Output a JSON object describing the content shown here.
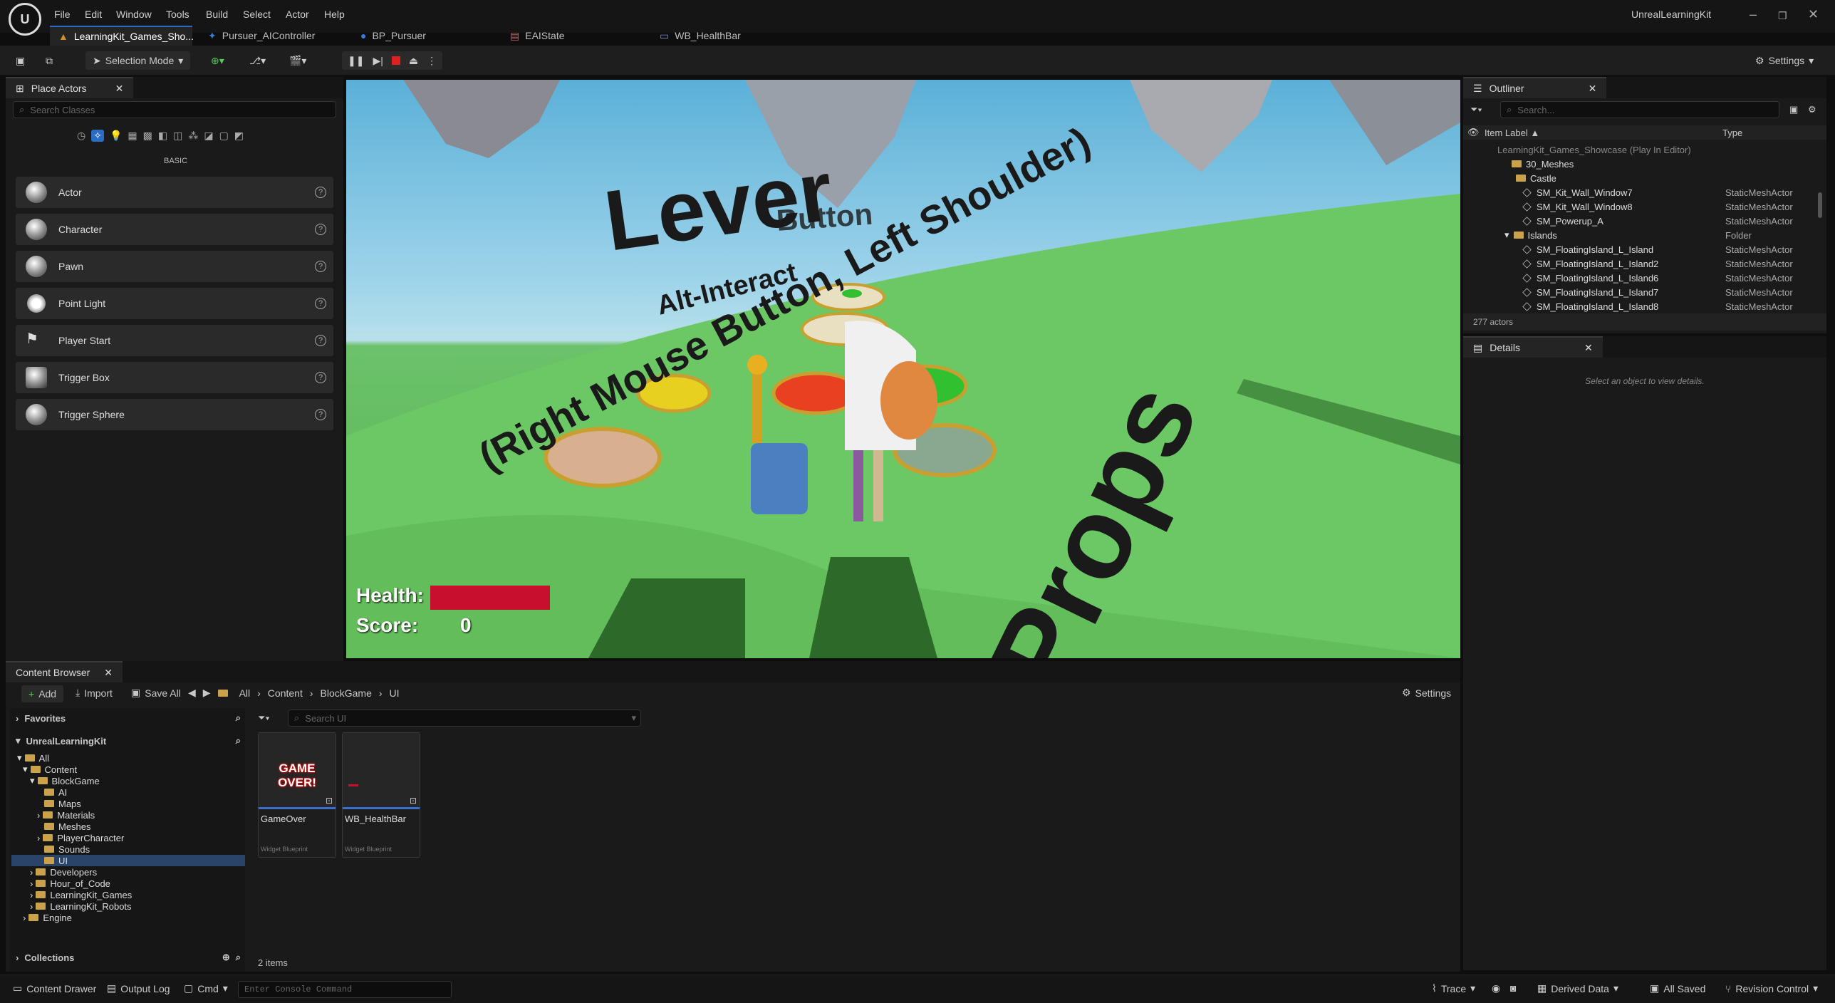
{
  "app": {
    "title": "UnrealLearningKit"
  },
  "menu": [
    "File",
    "Edit",
    "Window",
    "Tools",
    "Build",
    "Select",
    "Actor",
    "Help"
  ],
  "tabs": [
    {
      "label": "LearningKit_Games_Sho..."
    },
    {
      "label": "Pursuer_AIController"
    },
    {
      "label": "BP_Pursuer"
    },
    {
      "label": "EAIState"
    },
    {
      "label": "WB_HealthBar"
    }
  ],
  "toolbar": {
    "mode_label": "Selection Mode",
    "settings_label": "Settings"
  },
  "place_actors": {
    "tab_label": "Place Actors",
    "search_placeholder": "Search Classes",
    "category_label": "BASIC",
    "items": [
      {
        "label": "Actor"
      },
      {
        "label": "Character"
      },
      {
        "label": "Pawn"
      },
      {
        "label": "Point Light"
      },
      {
        "label": "Player Start"
      },
      {
        "label": "Trigger Box"
      },
      {
        "label": "Trigger Sphere"
      }
    ]
  },
  "viewport": {
    "hud": {
      "health_label": "Health:",
      "score_label": "Score:",
      "score_value": "0",
      "health_fraction": 1.0
    },
    "scene_text": {
      "lever": "Lever",
      "button": "Button",
      "alt_interact": "Alt-Interact",
      "mouse_hint": "(Right Mouse Button, Left Shoulder)",
      "props": "Props"
    }
  },
  "outliner": {
    "tab_label": "Outliner",
    "search_placeholder": "Search...",
    "col_label": "Item Label ▲",
    "col_type": "Type",
    "rows": [
      {
        "label": "LearningKit_Games_Showcase (Play In Editor)",
        "type": ""
      },
      {
        "label": "30_Meshes",
        "type": ""
      },
      {
        "label": "Castle",
        "type": ""
      },
      {
        "label": "SM_Kit_Wall_Window7",
        "type": "StaticMeshActor"
      },
      {
        "label": "SM_Kit_Wall_Window8",
        "type": "StaticMeshActor"
      },
      {
        "label": "SM_Powerup_A",
        "type": "StaticMeshActor"
      },
      {
        "label": "Islands",
        "type": "Folder"
      },
      {
        "label": "SM_FloatingIsland_L_Island",
        "type": "StaticMeshActor"
      },
      {
        "label": "SM_FloatingIsland_L_Island2",
        "type": "StaticMeshActor"
      },
      {
        "label": "SM_FloatingIsland_L_Island6",
        "type": "StaticMeshActor"
      },
      {
        "label": "SM_FloatingIsland_L_Island7",
        "type": "StaticMeshActor"
      },
      {
        "label": "SM_FloatingIsland_L_Island8",
        "type": "StaticMeshActor"
      }
    ],
    "count": "277 actors"
  },
  "details": {
    "tab_label": "Details",
    "empty": "Select an object to view details."
  },
  "content_browser": {
    "tab_label": "Content Browser",
    "add_label": "Add",
    "import_label": "Import",
    "save_all_label": "Save All",
    "breadcrumb": [
      "All",
      "Content",
      "BlockGame",
      "UI"
    ],
    "settings_label": "Settings",
    "favorites_label": "Favorites",
    "project_label": "UnrealLearningKit",
    "search_placeholder": "Search UI",
    "tree": [
      "All",
      "Content",
      "BlockGame",
      "AI",
      "Maps",
      "Materials",
      "Meshes",
      "PlayerCharacter",
      "Sounds",
      "UI",
      "Developers",
      "Hour_of_Code",
      "LearningKit_Games",
      "LearningKit_Robots",
      "Engine"
    ],
    "collections_label": "Collections",
    "assets": [
      {
        "name": "GameOver",
        "type": "Widget Blueprint",
        "thumb_text": "GAME OVER!"
      },
      {
        "name": "WB_HealthBar",
        "type": "Widget Blueprint",
        "thumb_text": ""
      }
    ],
    "item_count": "2 items"
  },
  "statusbar": {
    "content_drawer": "Content Drawer",
    "output_log": "Output Log",
    "cmd": "Cmd",
    "console_placeholder": "Enter Console Command",
    "trace": "Trace",
    "derived_data": "Derived Data",
    "all_saved": "All Saved",
    "revision_control": "Revision Control"
  },
  "colors": {
    "accent": "#2b6cc4",
    "health": "#c8102e",
    "folder": "#c9a24a"
  }
}
